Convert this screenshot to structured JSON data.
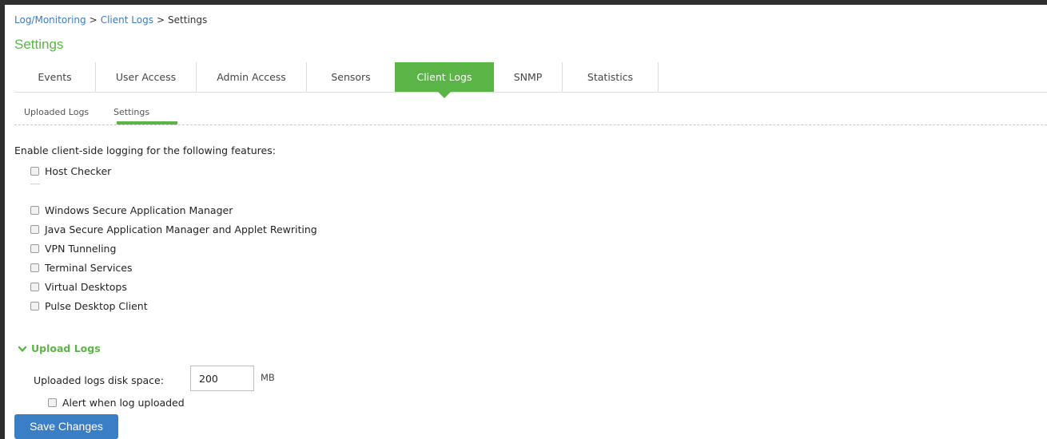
{
  "breadcrumb": {
    "part1": "Log/Monitoring",
    "sep1": ">",
    "part2": "Client Logs",
    "sep2": ">",
    "part3": "Settings"
  },
  "page": {
    "title": "Settings"
  },
  "tabs": [
    {
      "label": "Events"
    },
    {
      "label": "User Access"
    },
    {
      "label": "Admin Access"
    },
    {
      "label": "Sensors"
    },
    {
      "label": "Client Logs",
      "active": true
    },
    {
      "label": "SNMP"
    },
    {
      "label": "Statistics"
    }
  ],
  "subtabs": [
    {
      "label": "Uploaded Logs"
    },
    {
      "label": "Settings",
      "active": true
    }
  ],
  "logging": {
    "intro": "Enable client-side logging for the following features:",
    "features": [
      {
        "label": "Host Checker",
        "checked": false
      },
      {
        "label": "Windows Secure Application Manager",
        "checked": false
      },
      {
        "label": "Java Secure Application Manager and Applet Rewriting",
        "checked": false
      },
      {
        "label": "VPN Tunneling",
        "checked": false
      },
      {
        "label": "Terminal Services",
        "checked": false
      },
      {
        "label": "Virtual Desktops",
        "checked": false
      },
      {
        "label": "Pulse Desktop Client",
        "checked": false
      }
    ]
  },
  "upload": {
    "heading": "Upload Logs",
    "disk_label": "Uploaded logs disk space:",
    "disk_value": "200",
    "disk_unit": "MB",
    "alert_label": "Alert when log uploaded",
    "alert_checked": false
  },
  "actions": {
    "save_label": "Save Changes"
  },
  "colors": {
    "accent_green": "#5bb546",
    "link_blue": "#3a7ac1",
    "button_blue": "#3a7fc6"
  }
}
